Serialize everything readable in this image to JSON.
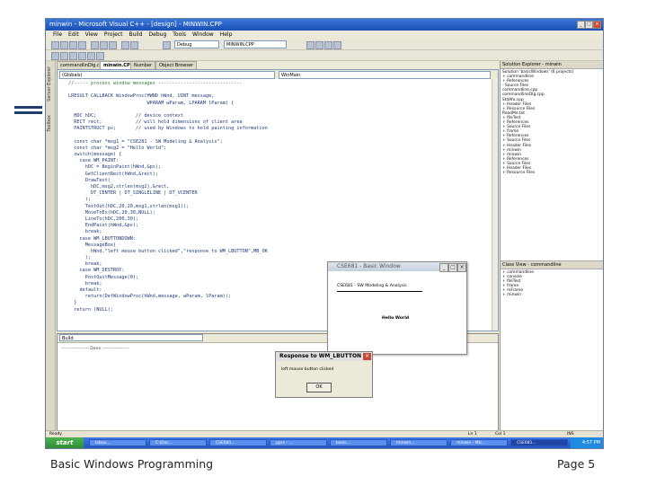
{
  "window": {
    "title": "minwin - Microsoft Visual C++ - [design] - MINWIN.CPP",
    "menu": [
      "File",
      "Edit",
      "View",
      "Project",
      "Build",
      "Debug",
      "Tools",
      "Window",
      "Help"
    ],
    "config_combo": "Debug",
    "file_combo": "MINWIN.CPP"
  },
  "editor": {
    "tabs": [
      "commandlinDlg.cpp",
      "minwin.CPP",
      "Number",
      "Object Browser"
    ],
    "scope_combo": "(Globals)",
    "member_combo": "WinMain"
  },
  "code_lines": [
    {
      "t": "//----- process window messages ------------------------------",
      "c": "cm"
    },
    {
      "t": "",
      "c": ""
    },
    {
      "t": "LRESULT CALLBACK WindowProc(HWND hWnd, UINT message,",
      "c": ""
    },
    {
      "t": "                            WPARAM wParam, LPARAM lParam) {",
      "c": ""
    },
    {
      "t": "",
      "c": ""
    },
    {
      "t": "  HDC hDC;              // device context",
      "c": ""
    },
    {
      "t": "  RECT rect;            // will hold dimensions of client area",
      "c": ""
    },
    {
      "t": "  PAINTSTRUCT ps;       // used by Windows to hold painting information",
      "c": ""
    },
    {
      "t": "",
      "c": ""
    },
    {
      "t": "  const char *msg1 = \"CSE281 - SW Modeling & Analysis\";",
      "c": ""
    },
    {
      "t": "  const char *msg2 = \"Hello World\";",
      "c": ""
    },
    {
      "t": "  switch(message) {",
      "c": ""
    },
    {
      "t": "    case WM_PAINT:",
      "c": ""
    },
    {
      "t": "      hDC = BeginPaint(hWnd,&ps);",
      "c": ""
    },
    {
      "t": "      GetClientRect(hWnd,&rect);",
      "c": ""
    },
    {
      "t": "      DrawText(",
      "c": ""
    },
    {
      "t": "        hDC,msg2,strlen(msg2),&rect,",
      "c": ""
    },
    {
      "t": "        DT_CENTER | DT_SINGLELINE | DT_VCENTER",
      "c": ""
    },
    {
      "t": "      );",
      "c": ""
    },
    {
      "t": "      TextOut(hDC,20,20,msg1,strlen(msg1));",
      "c": ""
    },
    {
      "t": "      MoveToEx(hDC,20,30,NULL);",
      "c": ""
    },
    {
      "t": "      LineTo(hDC,200,30);",
      "c": ""
    },
    {
      "t": "      EndPaint(hWnd,&ps);",
      "c": ""
    },
    {
      "t": "      break;",
      "c": ""
    },
    {
      "t": "    case WM_LBUTTONDOWN:",
      "c": ""
    },
    {
      "t": "      MessageBox(",
      "c": ""
    },
    {
      "t": "        hWnd,\"left mouse button clicked\",\"response to WM_LBUTTON\",MB_OK",
      "c": ""
    },
    {
      "t": "      );",
      "c": ""
    },
    {
      "t": "      break;",
      "c": ""
    },
    {
      "t": "    case WM_DESTROY:",
      "c": ""
    },
    {
      "t": "      PostQuitMessage(0);",
      "c": ""
    },
    {
      "t": "      break;",
      "c": ""
    },
    {
      "t": "    default:",
      "c": ""
    },
    {
      "t": "      return(DefWindowProc(hWnd,message, wParam, lParam));",
      "c": ""
    },
    {
      "t": "  }",
      "c": ""
    },
    {
      "t": "  return (NULL);",
      "c": ""
    }
  ],
  "left_tabs": [
    "Server Explorer",
    "Toolbox"
  ],
  "solution_explorer": {
    "title": "Solution Explorer - minwin",
    "items": [
      "Solution 'basicWindows' (6 projects)",
      "+ commandline",
      "   + References",
      "   - Source Files",
      "        commandline.cpp",
      "        commandlineDlg.cpp",
      "        StdAfx.cpp",
      "   + Header Files",
      "   + Resource Files",
      "     ReadMe.txt",
      "+ fileTest",
      "   + References",
      "   + Source Files",
      "+ frame",
      "   + References",
      "   + Source Files",
      "   + Header Files",
      "+ minwin",
      "+ minwin",
      "   + References",
      "   + Source Files",
      "   + Header Files",
      "   + Resource Files"
    ]
  },
  "class_view": {
    "title": "Class View - commandline",
    "items": [
      "+ commandline",
      "+ console",
      "+ fileTest",
      "+ frame",
      "+ mFrame",
      "+ minwin"
    ]
  },
  "output": {
    "combo": "Build",
    "text": "------------------- Done -------------------"
  },
  "app_window": {
    "title": "CSE681 - Basic Window",
    "line1": "CSE681 - SW Modeling & Analysis",
    "line2": "Hello World"
  },
  "message_box": {
    "title": "Response to WM_LBUTTON",
    "text": "left mouse button clicked",
    "ok_label": "OK"
  },
  "status": {
    "left": "Ready",
    "line": "Ln 1",
    "col": "Col 1",
    "mode": "INS"
  },
  "taskbar": {
    "start": "start",
    "tasks": [
      "Inbox...",
      "C:\\Doc...",
      "CSE681...",
      "pprs - ...",
      "basic...",
      "minwin...",
      "minwin - Mic...",
      "CSE681..."
    ],
    "clock": "4:57 PM"
  },
  "footer": {
    "left": "Basic Windows Programming",
    "right": "Page 5"
  }
}
